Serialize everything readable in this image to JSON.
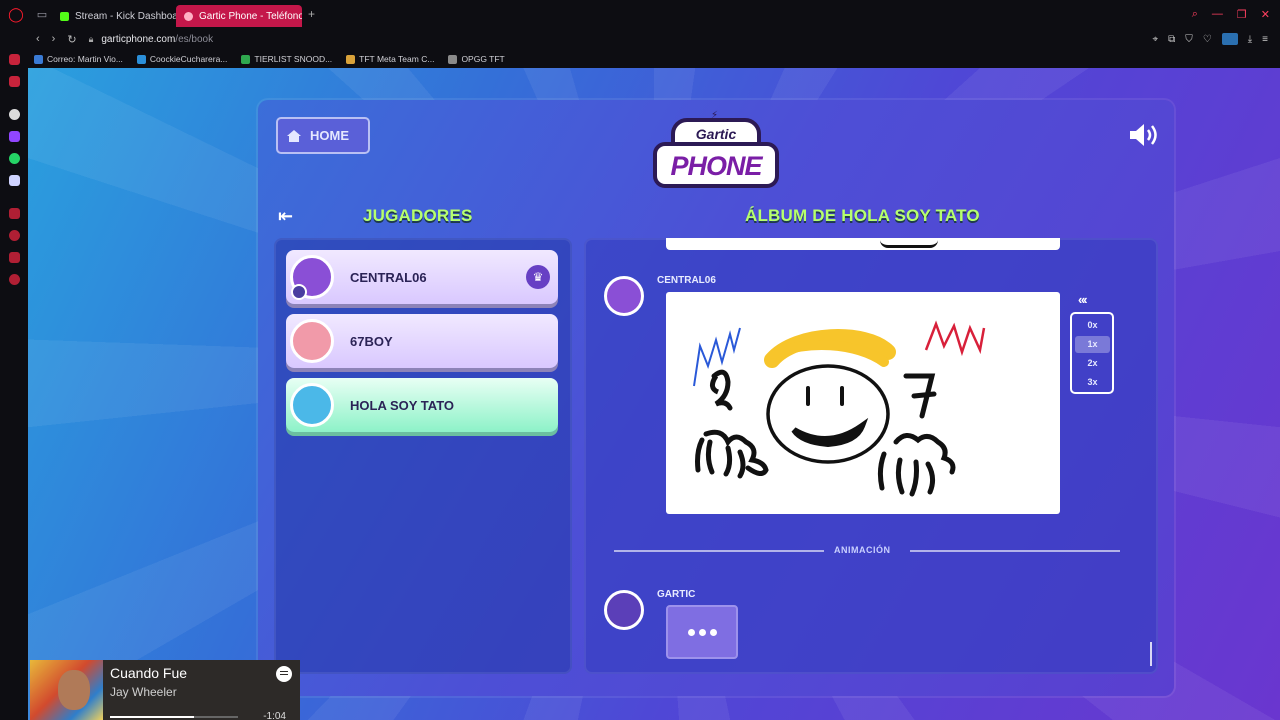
{
  "browser": {
    "tabs": [
      {
        "label": "Stream - Kick Dashboard",
        "active": false
      },
      {
        "label": "Gartic Phone - Teléfono De",
        "active": true
      }
    ],
    "url_host": "garticphone.com",
    "url_path": "/es/book",
    "bookmarks": [
      {
        "label": "Correo: Martin Vio...",
        "color": "#3a7bd5"
      },
      {
        "label": "CoockieCucharera...",
        "color": "#2b8fd9"
      },
      {
        "label": "TIERLIST SNOOD...",
        "color": "#2fa84f"
      },
      {
        "label": "TFT Meta Team C...",
        "color": "#d9a23a"
      },
      {
        "label": "OPGG TFT",
        "color": "#8a8a8a"
      }
    ]
  },
  "game": {
    "home_label": "HOME",
    "logo_top": "Gartic",
    "logo_bottom": "PHONE",
    "players_title": "JUGADORES",
    "album_title": "ÁLBUM DE HOLA SOY TATO",
    "players": [
      {
        "name": "CENTRAL06",
        "avatar_color": "#8a4fd6",
        "host": true
      },
      {
        "name": "67BOY",
        "avatar_color": "#f19aa9",
        "host": false
      },
      {
        "name": "HOLA SOY TATO",
        "avatar_color": "#4bb8e8",
        "host": false
      }
    ],
    "album": {
      "entries": [
        {
          "author": "CENTRAL06",
          "type": "drawing"
        },
        {
          "author": "GARTIC",
          "type": "typing"
        }
      ],
      "section_label": "ANIMACIÓN",
      "speed_options": [
        "0x",
        "1x",
        "2x",
        "3x"
      ],
      "selected_speed": "1x"
    }
  },
  "spotify": {
    "title": "Cuando Fue",
    "artist": "Jay Wheeler",
    "time": "-1:04",
    "progress": 0.66
  },
  "colors": {
    "title_green": "#b6ff6e",
    "tab_active": "#c4174a",
    "selected_player": "#8df2c8"
  }
}
